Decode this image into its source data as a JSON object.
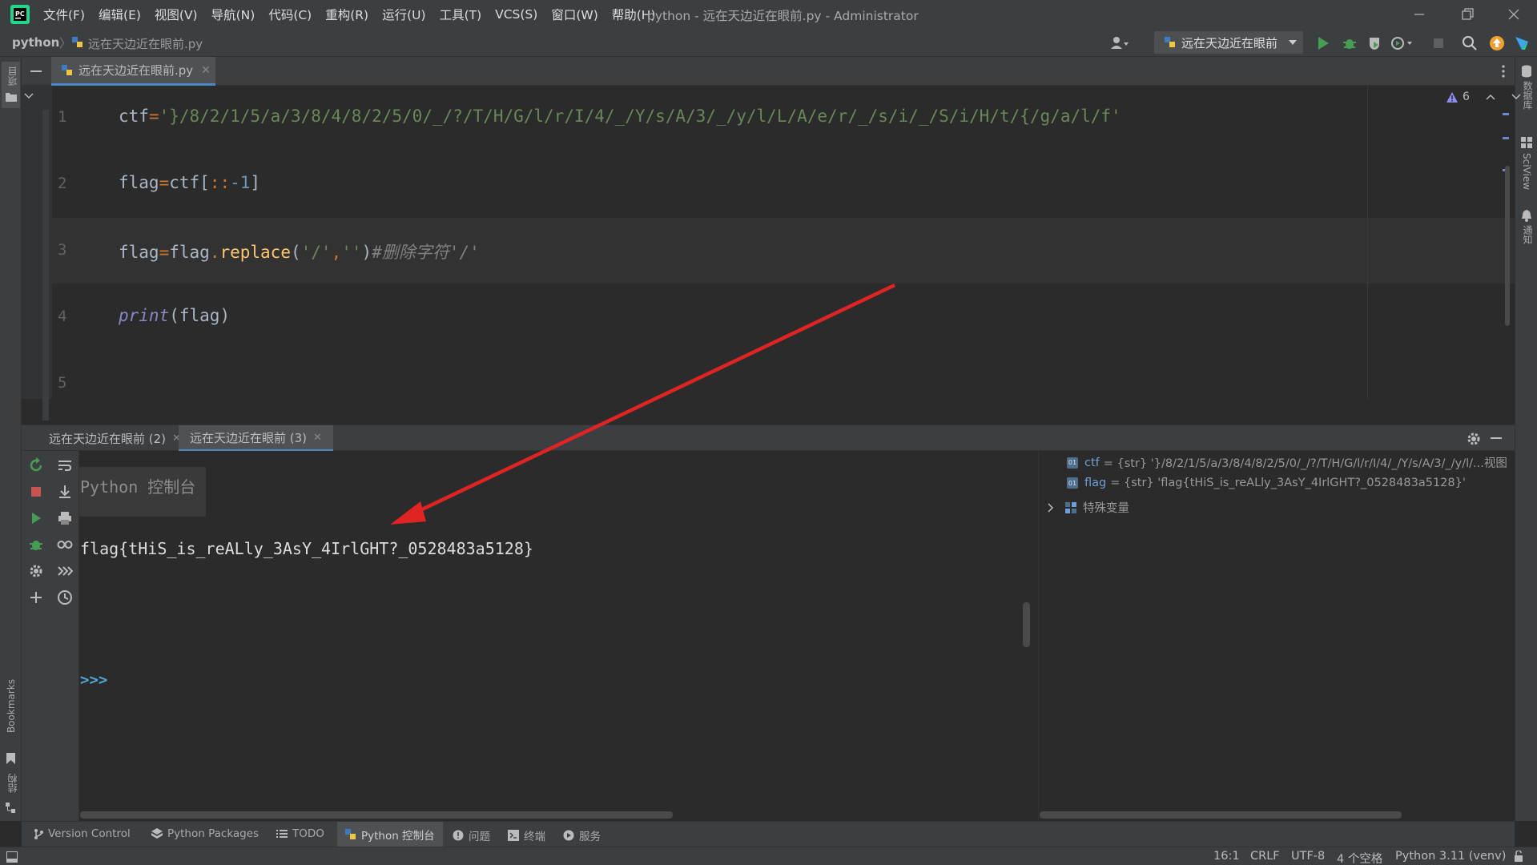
{
  "window": {
    "menu": [
      "文件(F)",
      "编辑(E)",
      "视图(V)",
      "导航(N)",
      "代码(C)",
      "重构(R)",
      "运行(U)",
      "工具(T)",
      "VCS(S)",
      "窗口(W)",
      "帮助(H)"
    ],
    "title": "python - 远在天边近在眼前.py - Administrator"
  },
  "navbar": {
    "project": "python",
    "file": "远在天边近在眼前.py",
    "run_config": "远在天边近在眼前"
  },
  "left_strip": {
    "project_label": "项目",
    "bookmarks_label": "Bookmarks",
    "structure_label": "结构"
  },
  "right_strip": {
    "database_label": "数据库",
    "sciview_label": "SciView",
    "notifications_label": "通知"
  },
  "editor": {
    "tab_label": "远在天边近在眼前.py",
    "inspection_count": "6",
    "lines": [
      {
        "no": "1",
        "tokens": [
          {
            "t": "ctf",
            "c": "c-id"
          },
          {
            "t": "=",
            "c": "c-op"
          },
          {
            "t": "'}/8/2/1/5/a/3/8/4/8/2/5/0/_/?/T/H/G/l/r/I/4/_/Y/s/A/3/_/y/l/L/A/e/r/_/s/i/_/S/i/H/t/{/g/a/l/f'",
            "c": "c-str"
          }
        ]
      },
      {
        "no": "2",
        "tokens": [
          {
            "t": "flag",
            "c": "c-id"
          },
          {
            "t": "=",
            "c": "c-op"
          },
          {
            "t": "ctf",
            "c": "c-id"
          },
          {
            "t": "[",
            "c": "c-brk"
          },
          {
            "t": "::",
            "c": "c-op"
          },
          {
            "t": "-1",
            "c": "c-num"
          },
          {
            "t": "]",
            "c": "c-brk"
          }
        ]
      },
      {
        "no": "3",
        "tokens": [
          {
            "t": "flag",
            "c": "c-id"
          },
          {
            "t": "=",
            "c": "c-op"
          },
          {
            "t": "flag",
            "c": "c-id"
          },
          {
            "t": ".",
            "c": "c-op"
          },
          {
            "t": "replace",
            "c": "c-fn"
          },
          {
            "t": "(",
            "c": "c-brk"
          },
          {
            "t": "'/'",
            "c": "c-str"
          },
          {
            "t": ",",
            "c": "c-op"
          },
          {
            "t": "''",
            "c": "c-str"
          },
          {
            "t": ")",
            "c": "c-brk"
          },
          {
            "t": "#删除字符'/'",
            "c": "c-cmt"
          }
        ]
      },
      {
        "no": "4",
        "tokens": [
          {
            "t": "print",
            "c": "c-builtin"
          },
          {
            "t": "(",
            "c": "c-brk"
          },
          {
            "t": "flag",
            "c": "c-id"
          },
          {
            "t": ")",
            "c": "c-brk"
          }
        ]
      },
      {
        "no": "5",
        "tokens": []
      }
    ]
  },
  "run": {
    "tabs": [
      "远在天边近在眼前 (2)",
      "远在天边近在眼前 (3)"
    ],
    "console_banner": "Python 控制台",
    "console_output": "flag{tHiS_is_reALly_3AsY_4IrlGHT?_0528483a5128}",
    "prompt": ">>>"
  },
  "variables": [
    {
      "name": "ctf",
      "value": "= {str} '}/8/2/1/5/a/3/8/4/8/2/5/0/_/?/T/H/G/l/r/I/4/_/Y/s/A/3/_/y/l/...视图"
    },
    {
      "name": "flag",
      "value": "= {str} 'flag{tHiS_is_reALly_3AsY_4IrlGHT?_0528483a5128}'"
    },
    {
      "name": "特殊变量",
      "value": ""
    }
  ],
  "bottom_tabs": [
    "Version Control",
    "Python Packages",
    "TODO",
    "Python 控制台",
    "问题",
    "终端",
    "服务"
  ],
  "status": {
    "position": "16:1",
    "line_sep": "CRLF",
    "encoding": "UTF-8",
    "indent": "4 个空格",
    "interpreter": "Python 3.11 (venv)"
  },
  "colors": {
    "annotation_arrow": "#e02424",
    "accent": "#4a88c7"
  }
}
